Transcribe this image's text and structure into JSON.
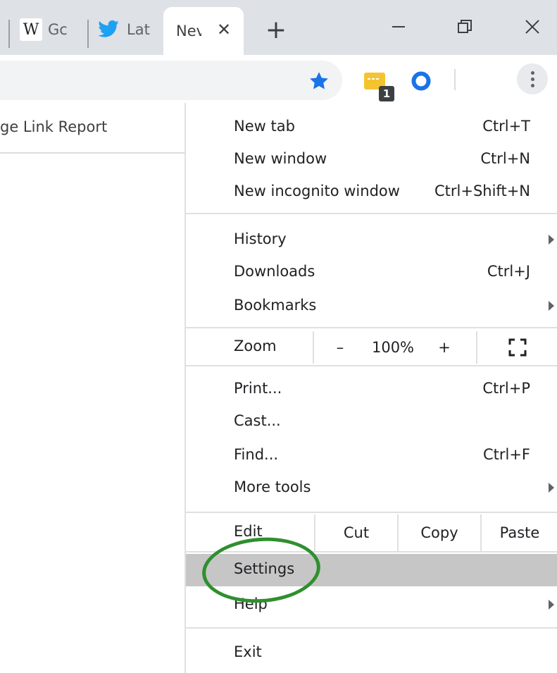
{
  "tabs": [
    {
      "title": "Gc",
      "icon": "wikipedia-icon",
      "icon_glyph": "W"
    },
    {
      "title": "Lat",
      "icon": "twitter-bird-icon"
    },
    {
      "title": "Nev",
      "icon": "",
      "active": true
    }
  ],
  "window_controls": [
    "minimize-icon",
    "restore-icon",
    "close-icon"
  ],
  "toolbar": {
    "icons": [
      "bookmark-star-icon",
      "extension-icon",
      "extension-ring-icon",
      "chrome-menu-icon"
    ],
    "extension_badge": "1",
    "colors": {
      "star": "#1a73e8",
      "extension": "#f4c430",
      "ring": "#1a73e8"
    }
  },
  "page": {
    "partial_text": "ge Link Report"
  },
  "menu": {
    "new_tab": {
      "label": "New tab",
      "shortcut": "Ctrl+T"
    },
    "new_window": {
      "label": "New window",
      "shortcut": "Ctrl+N"
    },
    "incognito": {
      "label": "New incognito window",
      "shortcut": "Ctrl+Shift+N"
    },
    "history": {
      "label": "History"
    },
    "downloads": {
      "label": "Downloads",
      "shortcut": "Ctrl+J"
    },
    "bookmarks": {
      "label": "Bookmarks"
    },
    "zoom": {
      "label": "Zoom",
      "minus": "–",
      "value": "100%",
      "plus": "+"
    },
    "print": {
      "label": "Print...",
      "shortcut": "Ctrl+P"
    },
    "cast": {
      "label": "Cast..."
    },
    "find": {
      "label": "Find...",
      "shortcut": "Ctrl+F"
    },
    "more_tools": {
      "label": "More tools"
    },
    "edit": {
      "label": "Edit",
      "cut": "Cut",
      "copy": "Copy",
      "paste": "Paste"
    },
    "settings": {
      "label": "Settings"
    },
    "help": {
      "label": "Help"
    },
    "exit": {
      "label": "Exit"
    }
  },
  "annotation": {
    "color": "#2f8f2f",
    "target": "settings"
  }
}
